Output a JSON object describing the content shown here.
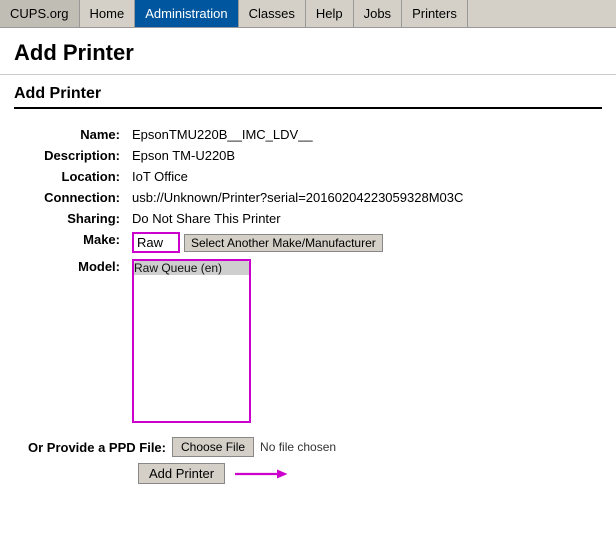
{
  "nav": {
    "brand": "CUPS.org",
    "items": [
      {
        "label": "Home",
        "active": false
      },
      {
        "label": "Administration",
        "active": true
      },
      {
        "label": "Classes",
        "active": false
      },
      {
        "label": "Help",
        "active": false
      },
      {
        "label": "Jobs",
        "active": false
      },
      {
        "label": "Printers",
        "active": false
      }
    ]
  },
  "page_title": "Add Printer",
  "section_title": "Add Printer",
  "form": {
    "name_label": "Name:",
    "name_value": "EpsonTMU220B__IMC_LDV__",
    "description_label": "Description:",
    "description_value": "Epson TM-U220B",
    "location_label": "Location:",
    "location_value": "IoT Office",
    "connection_label": "Connection:",
    "connection_value": "usb://Unknown/Printer?serial=20160204223059328M03C",
    "sharing_label": "Sharing:",
    "sharing_value": "Do Not Share This Printer",
    "make_label": "Make:",
    "make_value": "Raw",
    "select_make_btn": "Select Another Make/Manufacturer",
    "model_label": "Model:",
    "model_options": [
      {
        "value": "raw_en",
        "label": "Raw Queue (en)"
      }
    ],
    "ppd_label": "Or Provide a PPD File:",
    "choose_file_btn": "Choose File",
    "no_file_text": "No file chosen",
    "add_printer_btn": "Add Printer"
  }
}
